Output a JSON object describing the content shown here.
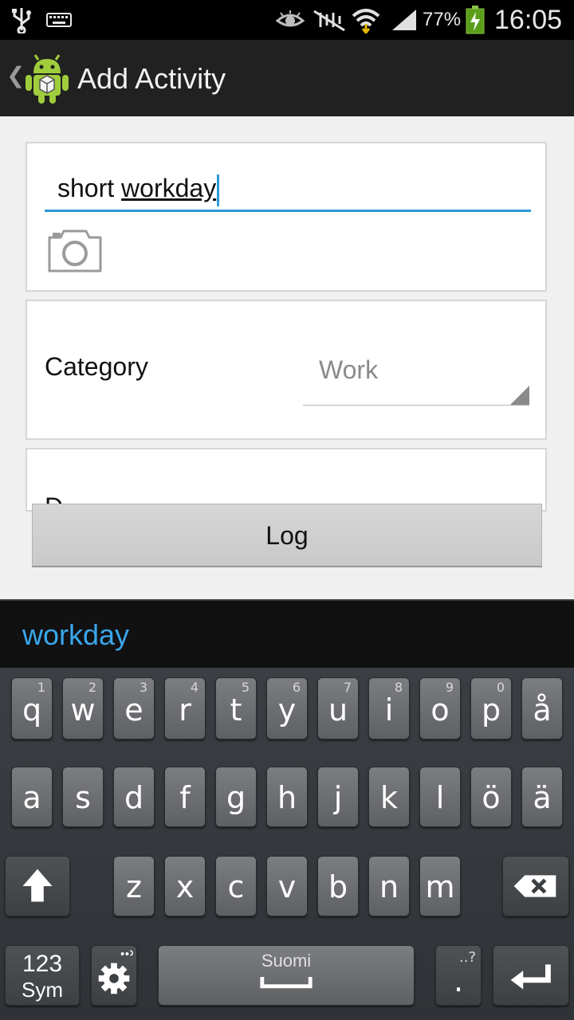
{
  "status_bar": {
    "battery_percent": "77%",
    "time": "16:05",
    "icons": [
      "usb-icon",
      "keyboard-icon",
      "eye-icon",
      "mute-icon",
      "wifi-icon",
      "signal-icon",
      "battery-charging-icon"
    ]
  },
  "action_bar": {
    "title": "Add Activity"
  },
  "form": {
    "name_value_plain": "short ",
    "name_value_underlined": "workday",
    "category_label": "Category",
    "category_value": "Work",
    "third_label_partial": "D"
  },
  "log_button": "Log",
  "suggestion": "workday",
  "keyboard": {
    "row1": [
      {
        "key": "q",
        "sub": "1"
      },
      {
        "key": "w",
        "sub": "2"
      },
      {
        "key": "e",
        "sub": "3"
      },
      {
        "key": "r",
        "sub": "4"
      },
      {
        "key": "t",
        "sub": "5"
      },
      {
        "key": "y",
        "sub": "6"
      },
      {
        "key": "u",
        "sub": "7"
      },
      {
        "key": "i",
        "sub": "8"
      },
      {
        "key": "o",
        "sub": "9"
      },
      {
        "key": "p",
        "sub": "0"
      },
      {
        "key": "å",
        "sub": ""
      }
    ],
    "row2": [
      "a",
      "s",
      "d",
      "f",
      "g",
      "h",
      "j",
      "k",
      "l",
      "ö",
      "ä"
    ],
    "row3": [
      "z",
      "x",
      "c",
      "v",
      "b",
      "n",
      "m"
    ],
    "sym_top": "123",
    "sym_bottom": "Sym",
    "space_label": "Suomi",
    "period": ".",
    "period_sub": "..?"
  },
  "colors": {
    "accent": "#2a9ad8",
    "suggestion": "#3aa6ec"
  }
}
